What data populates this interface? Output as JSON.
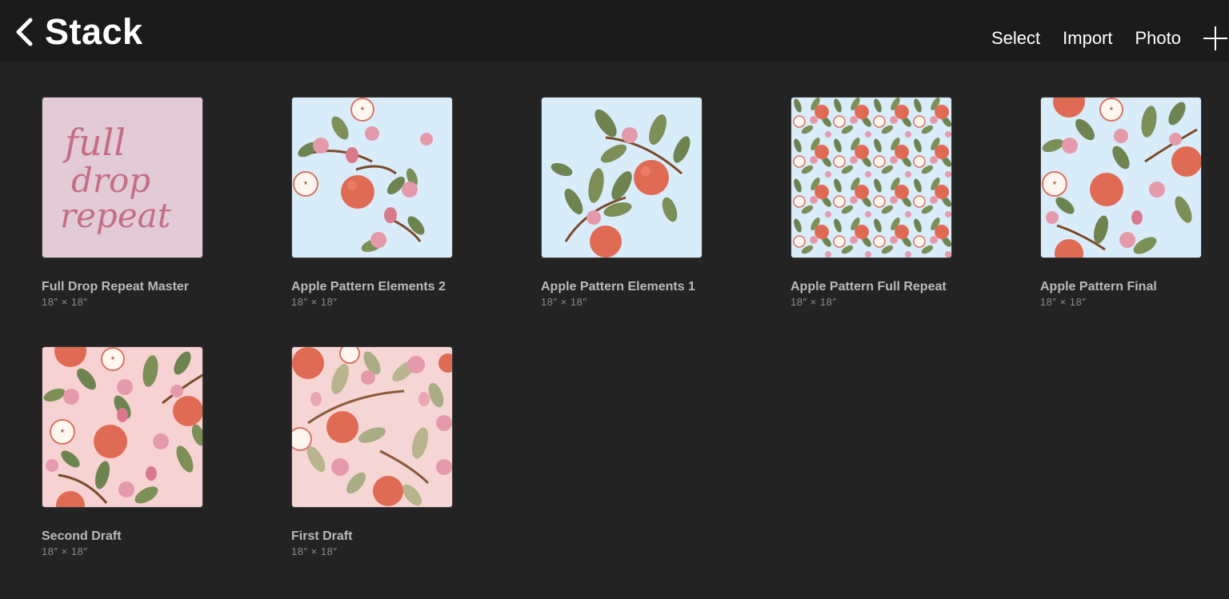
{
  "header": {
    "title": "Stack",
    "actions": [
      "Select",
      "Import",
      "Photo"
    ]
  },
  "colors": {
    "background": "#232323",
    "topbar": "#1b1b1b",
    "text_primary": "#ffffff",
    "text_secondary": "#b9b9b9"
  },
  "artworks": [
    {
      "name": "Full Drop Repeat Master",
      "size": "18″ × 18″",
      "thumbnail": "handwritten-text",
      "thumb_text": [
        "full",
        "drop",
        "repeat"
      ]
    },
    {
      "name": "Apple Pattern Elements 2",
      "size": "18″ × 18″",
      "thumbnail": "apple-elements-blue"
    },
    {
      "name": "Apple Pattern Elements 1",
      "size": "18″ × 18″",
      "thumbnail": "apple-branches-blue"
    },
    {
      "name": "Apple Pattern Full Repeat",
      "size": "18″ × 18″",
      "thumbnail": "apple-dense-blue"
    },
    {
      "name": "Apple Pattern Final",
      "size": "18″ × 18″",
      "thumbnail": "apple-final-blue"
    },
    {
      "name": "Second Draft",
      "size": "18″ × 18″",
      "thumbnail": "apple-pink"
    },
    {
      "name": "First Draft",
      "size": "18″ × 18″",
      "thumbnail": "apple-pink-light"
    }
  ]
}
